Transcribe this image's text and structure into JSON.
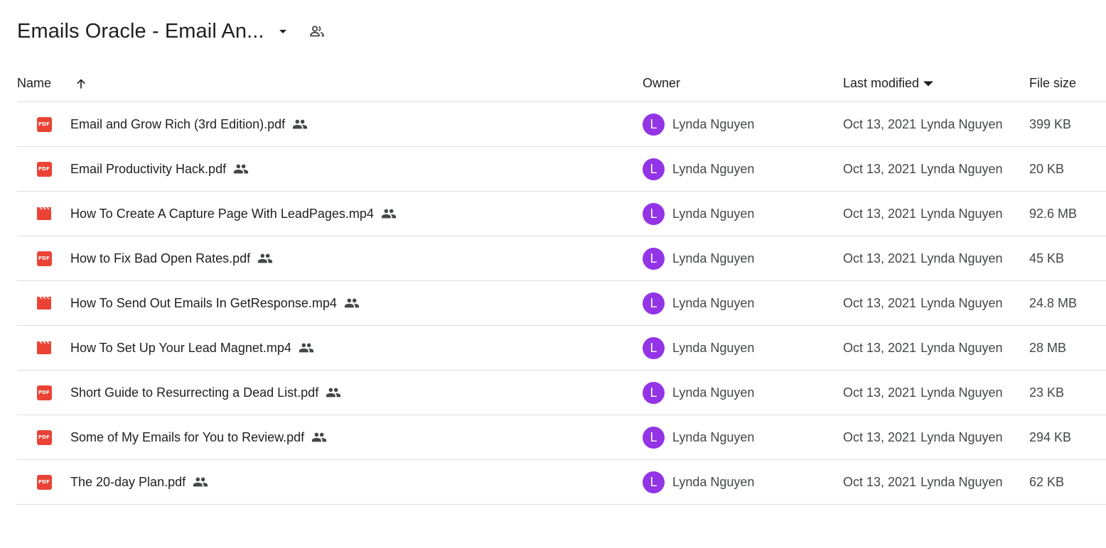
{
  "header": {
    "folder_title": "Emails Oracle - Email An...",
    "dropdown_icon": "arrow-drop-down-icon",
    "shared_icon": "people-outline-icon"
  },
  "columns": {
    "name": "Name",
    "owner": "Owner",
    "last_modified": "Last modified",
    "file_size": "File size"
  },
  "colors": {
    "pdf": "#ea4335",
    "video": "#ea4335",
    "avatar": "#9334e6",
    "text_primary": "#1f1f1f",
    "text_secondary": "#444746",
    "divider": "#dadce0"
  },
  "files": [
    {
      "name": "Email and Grow Rich (3rd Edition).pdf",
      "type": "pdf",
      "icon_label": "PDF",
      "owner_initial": "L",
      "owner": "Lynda Nguyen",
      "modified_date": "Oct 13, 2021",
      "modified_by": "Lynda Nguyen",
      "size": "399 KB"
    },
    {
      "name": "Email Productivity Hack.pdf",
      "type": "pdf",
      "icon_label": "PDF",
      "owner_initial": "L",
      "owner": "Lynda Nguyen",
      "modified_date": "Oct 13, 2021",
      "modified_by": "Lynda Nguyen",
      "size": "20 KB"
    },
    {
      "name": "How To Create A Capture Page With LeadPages.mp4",
      "type": "video",
      "icon_label": "",
      "owner_initial": "L",
      "owner": "Lynda Nguyen",
      "modified_date": "Oct 13, 2021",
      "modified_by": "Lynda Nguyen",
      "size": "92.6 MB"
    },
    {
      "name": "How to Fix Bad Open Rates.pdf",
      "type": "pdf",
      "icon_label": "PDF",
      "owner_initial": "L",
      "owner": "Lynda Nguyen",
      "modified_date": "Oct 13, 2021",
      "modified_by": "Lynda Nguyen",
      "size": "45 KB"
    },
    {
      "name": "How To Send Out Emails In GetResponse.mp4",
      "type": "video",
      "icon_label": "",
      "owner_initial": "L",
      "owner": "Lynda Nguyen",
      "modified_date": "Oct 13, 2021",
      "modified_by": "Lynda Nguyen",
      "size": "24.8 MB"
    },
    {
      "name": "How To Set Up Your Lead Magnet.mp4",
      "type": "video",
      "icon_label": "",
      "owner_initial": "L",
      "owner": "Lynda Nguyen",
      "modified_date": "Oct 13, 2021",
      "modified_by": "Lynda Nguyen",
      "size": "28 MB"
    },
    {
      "name": "Short Guide to Resurrecting a Dead List.pdf",
      "type": "pdf",
      "icon_label": "PDF",
      "owner_initial": "L",
      "owner": "Lynda Nguyen",
      "modified_date": "Oct 13, 2021",
      "modified_by": "Lynda Nguyen",
      "size": "23 KB"
    },
    {
      "name": "Some of My Emails for You to Review.pdf",
      "type": "pdf",
      "icon_label": "PDF",
      "owner_initial": "L",
      "owner": "Lynda Nguyen",
      "modified_date": "Oct 13, 2021",
      "modified_by": "Lynda Nguyen",
      "size": "294 KB"
    },
    {
      "name": "The 20-day Plan.pdf",
      "type": "pdf",
      "icon_label": "PDF",
      "owner_initial": "L",
      "owner": "Lynda Nguyen",
      "modified_date": "Oct 13, 2021",
      "modified_by": "Lynda Nguyen",
      "size": "62 KB"
    }
  ]
}
